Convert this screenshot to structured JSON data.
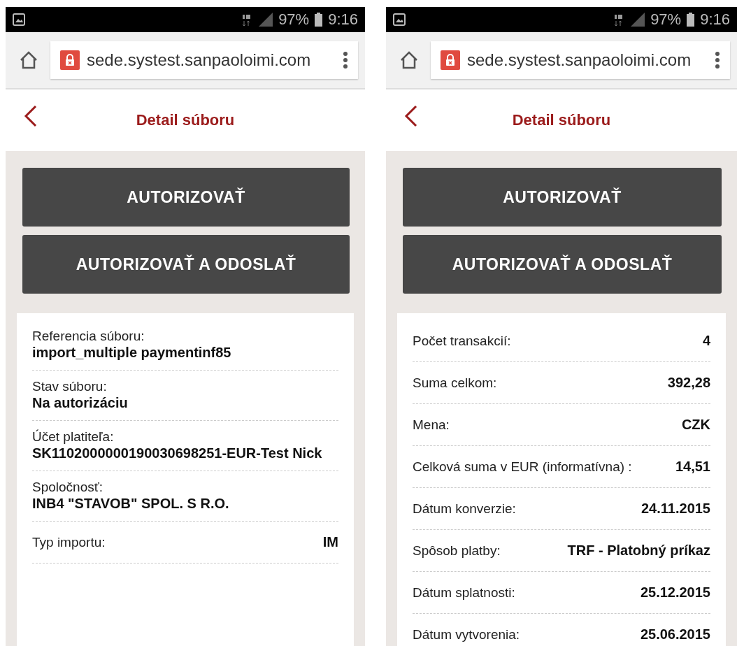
{
  "phones": [
    {
      "status_bar": {
        "battery": "97%",
        "time": "9:16"
      },
      "address_bar": {
        "url": "sede.systest.sanpaoloimi.com"
      },
      "header": {
        "title": "Detail súboru"
      },
      "buttons": [
        "AUTORIZOVAŤ",
        "AUTORIZOVAŤ A ODOSLAŤ"
      ],
      "details": [
        {
          "kind": "stacked",
          "label": "Referencia súboru:",
          "value": "import_multiple paymentinf85"
        },
        {
          "kind": "stacked",
          "label": "Stav súboru:",
          "value": "Na autorizáciu"
        },
        {
          "kind": "stacked",
          "label": "Účet platiteľa:",
          "value": "SK1102000000190030698251-EUR-Test Nick"
        },
        {
          "kind": "stacked",
          "label": "Spoločnosť:",
          "value": "INB4 \"STAVOB\" SPOL. S R.O."
        },
        {
          "kind": "inline",
          "label": "Typ importu:",
          "value": "IM"
        }
      ]
    },
    {
      "status_bar": {
        "battery": "97%",
        "time": "9:16"
      },
      "address_bar": {
        "url": "sede.systest.sanpaoloimi.com"
      },
      "header": {
        "title": "Detail súboru"
      },
      "buttons": [
        "AUTORIZOVAŤ",
        "AUTORIZOVAŤ A ODOSLAŤ"
      ],
      "details": [
        {
          "kind": "inline",
          "label": "Počet transakcií:",
          "value": "4"
        },
        {
          "kind": "inline",
          "label": "Suma celkom:",
          "value": "392,28"
        },
        {
          "kind": "inline",
          "label": "Mena:",
          "value": "CZK"
        },
        {
          "kind": "inline",
          "label": "Celková suma v EUR (informatívna) :",
          "value": "14,51"
        },
        {
          "kind": "inline",
          "label": "Dátum konverzie:",
          "value": "24.11.2015"
        },
        {
          "kind": "inline",
          "label": "Spôsob platby:",
          "value": "TRF - Platobný príkaz"
        },
        {
          "kind": "inline",
          "label": "Dátum splatnosti:",
          "value": "25.12.2015"
        },
        {
          "kind": "inline",
          "label": "Dátum vytvorenia:",
          "value": "25.06.2015"
        }
      ]
    }
  ]
}
